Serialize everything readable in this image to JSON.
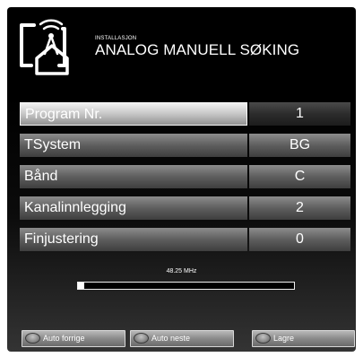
{
  "header": {
    "section": "INSTALLASJON",
    "title": "ANALOG MANUELL SØKING",
    "icon": "antenna-house-icon"
  },
  "menu": {
    "selected_index": 0,
    "rows": [
      {
        "label": "Program Nr.",
        "value": "1"
      },
      {
        "label": "TSystem",
        "value": "BG"
      },
      {
        "label": "Bånd",
        "value": "C"
      },
      {
        "label": "Kanalinnlegging",
        "value": "2"
      },
      {
        "label": "Finjustering",
        "value": "0"
      }
    ]
  },
  "scan": {
    "frequency": "48.25 MHz",
    "progress_percent": 3
  },
  "softkeys": [
    {
      "label": "Auto forrige",
      "icon": "red-key-icon"
    },
    {
      "label": "Auto neste",
      "icon": "green-key-icon"
    },
    {
      "label": "Lagre",
      "icon": "blue-key-icon"
    }
  ],
  "colors": {
    "background": "#000000",
    "highlight": "#d9d9d9",
    "text": "#ffffff"
  }
}
